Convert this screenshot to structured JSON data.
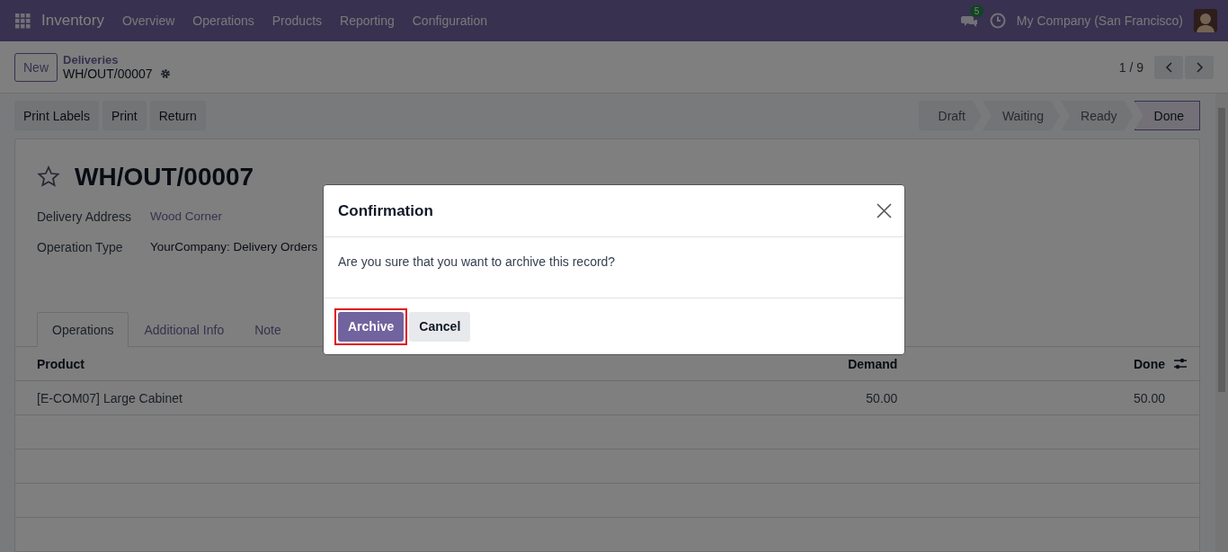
{
  "navbar": {
    "app_name": "Inventory",
    "menu": [
      "Overview",
      "Operations",
      "Products",
      "Reporting",
      "Configuration"
    ],
    "messages_badge": "5",
    "company": "My Company (San Francisco)"
  },
  "control_panel": {
    "new_button": "New",
    "breadcrumb": "Deliveries",
    "record": "WH/OUT/00007",
    "pager": "1 / 9"
  },
  "actions": [
    "Print Labels",
    "Print",
    "Return"
  ],
  "statusbar": [
    {
      "label": "Draft",
      "selected": false
    },
    {
      "label": "Waiting",
      "selected": false
    },
    {
      "label": "Ready",
      "selected": false
    },
    {
      "label": "Done",
      "selected": true
    }
  ],
  "sheet": {
    "title": "WH/OUT/00007",
    "fields": [
      {
        "label": "Delivery Address",
        "value": "Wood Corner",
        "kind": "link"
      },
      {
        "label": "Operation Type",
        "value": "YourCompany: Delivery Orders",
        "kind": "text"
      }
    ],
    "tabs": [
      {
        "label": "Operations",
        "selected": true
      },
      {
        "label": "Additional Info",
        "selected": false
      },
      {
        "label": "Note",
        "selected": false
      }
    ],
    "table": {
      "columns": [
        "Product",
        "Demand",
        "Done"
      ],
      "rows": [
        [
          "[E-COM07] Large Cabinet",
          "50.00",
          "50.00"
        ]
      ]
    }
  },
  "dialog": {
    "title": "Confirmation",
    "message": "Are you sure that you want to archive this record?",
    "buttons": [
      {
        "label": "Archive",
        "kind": "primary",
        "highlighted": true
      },
      {
        "label": "Cancel",
        "kind": "secondary",
        "highlighted": false
      }
    ]
  }
}
